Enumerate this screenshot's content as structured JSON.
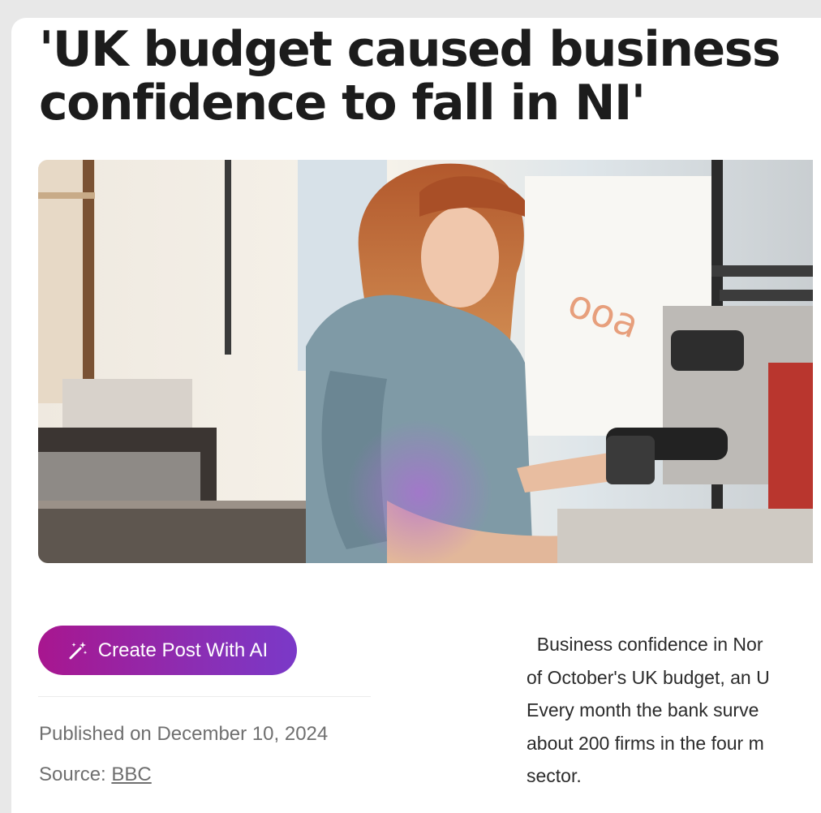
{
  "article": {
    "title": "'UK budget caused business\nconfidence to fall in NI'",
    "image_alt": "Woman operating an espresso machine in a cafe",
    "create_post_label": "Create Post With AI",
    "published_text": "Published on December 10, 2024",
    "source_prefix": "Source: ",
    "source_name": "BBC",
    "body_lines": [
      "  Business confidence in Nor",
      "of October's UK budget, an U",
      "Every month the bank surve",
      "about 200 firms in the four m",
      "sector."
    ]
  },
  "icons": {
    "create_post": "magic-wand-icon"
  },
  "colors": {
    "button_gradient_start": "#a8168f",
    "button_gradient_end": "#7a39c8",
    "title": "#1c1c1c",
    "meta_text": "#6f6f6f",
    "page_background": "#e8e8e8"
  }
}
